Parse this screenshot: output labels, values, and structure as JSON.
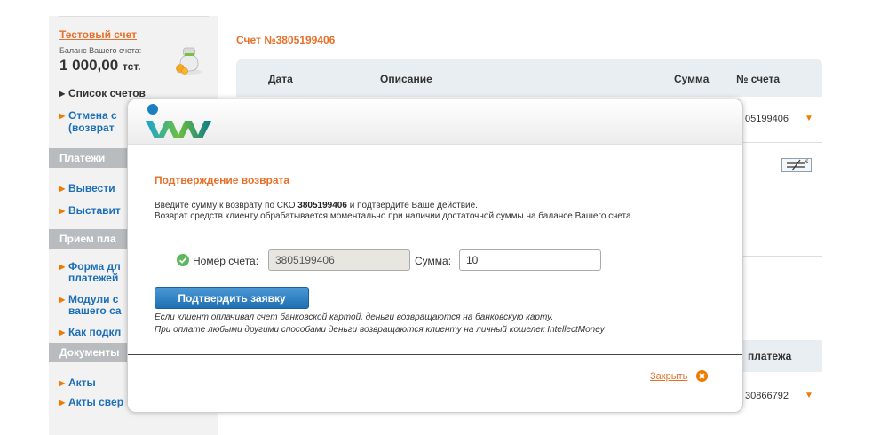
{
  "sidebar": {
    "account_link": "Тестовый счет",
    "balance_label": "Баланс Вашего счета:",
    "balance_value": "1 000,00",
    "balance_currency": "тст.",
    "items": [
      {
        "label": "Список счетов"
      },
      {
        "label": "Отмена с"
      },
      {
        "label": "(возврат"
      },
      {
        "label": "Вывести"
      },
      {
        "label": "Выставит"
      },
      {
        "label": "Форма дл"
      },
      {
        "label": "платежей"
      },
      {
        "label": "Модули с"
      },
      {
        "label": "вашего са"
      },
      {
        "label": "Как подкл"
      },
      {
        "label": "Акты"
      },
      {
        "label": "Акты свер"
      }
    ],
    "sections": [
      "Платежи",
      "Прием пла",
      "Документы"
    ]
  },
  "main": {
    "invoice_title": "Счет №3805199406",
    "columns": [
      "Дата",
      "Описание",
      "Сумма",
      "№ счета"
    ],
    "row_account": "05199406",
    "payment_header": "платежа",
    "row2_account": "30866792"
  },
  "modal": {
    "title": "Подтверждение возврата",
    "text_part1": "Введите сумму к возврату по СКО ",
    "text_account": "3805199406",
    "text_part2": " и подтвердите Ваше действие.",
    "text_line2": "Возврат средств клиенту обрабатывается моментально при наличии достаточной суммы на балансе Вашего счета.",
    "account_label": "Номер счета:",
    "account_value": "3805199406",
    "sum_label": "Сумма:",
    "sum_value": "10",
    "confirm_button": "Подтвердить заявку",
    "note1": "Если клиент оплачивал счет банковской картой, деньги возвращаются на банковскую карту.",
    "note2": "При оплате любыми другими способами деньги возвращаются клиенту на личный кошелек IntellectMoney",
    "close_label": "Закрыть"
  },
  "icons": {
    "money": "money-bag-icon",
    "ok": "check-circle-icon",
    "close": "close-circle-icon",
    "caret": "caret-down-icon",
    "not_equal": "not-equal-icon"
  },
  "colors": {
    "accent_orange": "#e8702a",
    "link_blue": "#1d6fb8",
    "button_blue": "#1f6fb3",
    "section_gray": "#b9bcbf",
    "ok_green": "#5cb85c"
  }
}
